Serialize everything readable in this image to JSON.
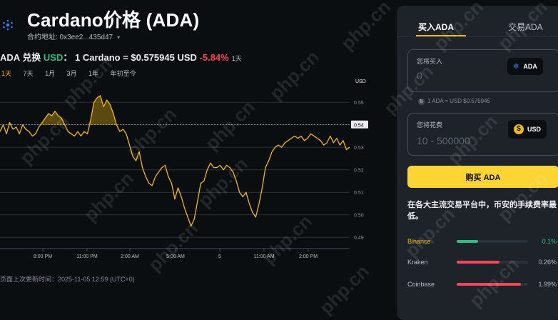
{
  "header": {
    "title": "Cardano价格 (ADA)",
    "contract_label": "合约地址: 0x3ee2...435d47",
    "pair_prefix": "ADA 兑换 ",
    "pair_quote": "USD",
    "pair_colon": "：",
    "price_text": "1 Cardano = $0.575945 USD",
    "change": "-5.84%",
    "change_period": "1天"
  },
  "range_tabs": [
    "1天",
    "7天",
    "1月",
    "3月",
    "1年",
    "年初至今"
  ],
  "range_selected": "1天",
  "chart_data": {
    "type": "line",
    "ylabel": "USD",
    "y_ticks": [
      "0.55",
      "0.54",
      "0.53",
      "0.52",
      "0.51",
      "0.50",
      "0.49"
    ],
    "x_ticks": [
      "8:00 PM",
      "11:00 PM",
      "2:00 AM",
      "5:00 AM",
      "5",
      "11:00 AM",
      "2:00 PM"
    ],
    "current_price_label": "0.54",
    "ylim": [
      0.485,
      0.558
    ],
    "baseline": 0.54,
    "color": "#f0b90b",
    "y": [
      0.537,
      0.54,
      0.536,
      0.541,
      0.538,
      0.539,
      0.536,
      0.54,
      0.538,
      0.537,
      0.535,
      0.536,
      0.539,
      0.541,
      0.543,
      0.545,
      0.544,
      0.546,
      0.544,
      0.543,
      0.54,
      0.537,
      0.536,
      0.535,
      0.537,
      0.535,
      0.537,
      0.536,
      0.542,
      0.55,
      0.552,
      0.553,
      0.548,
      0.551,
      0.549,
      0.545,
      0.54,
      0.537,
      0.538,
      0.536,
      0.531,
      0.526,
      0.524,
      0.528,
      0.521,
      0.517,
      0.514,
      0.513,
      0.517,
      0.519,
      0.521,
      0.522,
      0.517,
      0.514,
      0.507,
      0.512,
      0.508,
      0.503,
      0.499,
      0.495,
      0.498,
      0.506,
      0.514,
      0.515,
      0.52,
      0.523,
      0.521,
      0.521,
      0.522,
      0.52,
      0.522,
      0.521,
      0.519,
      0.515,
      0.51,
      0.508,
      0.51,
      0.505,
      0.501,
      0.499,
      0.505,
      0.512,
      0.521,
      0.524,
      0.528,
      0.53,
      0.531,
      0.53,
      0.532,
      0.533,
      0.534,
      0.535,
      0.534,
      0.535,
      0.533,
      0.534,
      0.536,
      0.535,
      0.534,
      0.533,
      0.531,
      0.532,
      0.535,
      0.532,
      0.534,
      0.531,
      0.533,
      0.529,
      0.53
    ]
  },
  "footer": {
    "updated": "页面上次更新时间：2025-11-05 12:59 (UTC+0)"
  },
  "trade_panel": {
    "tab_buy": "买入ADA",
    "tab_trade": "交易ADA",
    "field1_label": "您将买入",
    "field1_value": "0",
    "field1_coin": "ADA",
    "rate_text": "1 ADA ≈ USD $0.575945",
    "field2_label": "您将花费",
    "field2_value": "10 - 500000",
    "field2_coin": "USD",
    "buy_button": "购买 ADA",
    "fee_title": "在各大主流交易平台中，币安的手续费率最低。",
    "exchanges": [
      {
        "name": "Binance",
        "fee": "0.1%",
        "level": 0.3,
        "color": "#2ebd85",
        "text_color": "#f0b90b"
      },
      {
        "name": "Kraken",
        "fee": "0.26%",
        "level": 0.6,
        "color": "#f6465d",
        "text_color": "#b7bdc6"
      },
      {
        "name": "Coinbase",
        "fee": "1.99%",
        "level": 0.9,
        "color": "#f6465d",
        "text_color": "#b7bdc6"
      }
    ]
  },
  "watermark": "php.cn"
}
